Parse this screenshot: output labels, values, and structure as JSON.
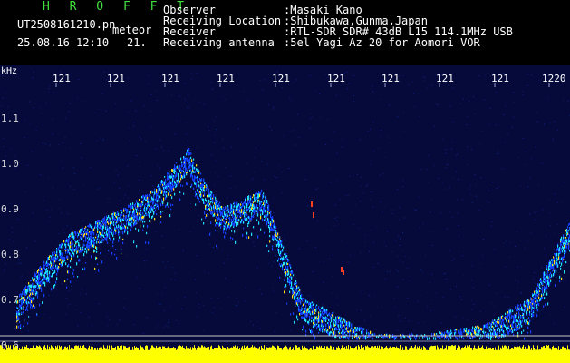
{
  "header": {
    "brand": "H R O F F T",
    "filename": "UT2508161210.pn",
    "type": "meteor",
    "datetime": "25.08.16 12:10",
    "seconds": "21.",
    "rows": [
      {
        "label": "Observer",
        "value": ":Masaki Kano"
      },
      {
        "label": "Receiving Location",
        "value": ":Shibukawa,Gunma,Japan"
      },
      {
        "label": "Receiver",
        "value": ":RTL-SDR SDR# 43dB L15 114.1MHz USB"
      },
      {
        "label": "Receiving antenna",
        "value": ":5el Yagi Az 20 for Aomori VOR"
      }
    ]
  },
  "plot": {
    "y_unit": "kHz",
    "y_ticks": [
      "1.1",
      "1.0",
      "0.9",
      "0.8",
      "0.7",
      "0.6"
    ],
    "x_ticks": [
      "121",
      "121",
      "121",
      "121",
      "121",
      "121",
      "121",
      "121",
      "121",
      "1220"
    ]
  },
  "colors": {
    "background": "#050a3a",
    "trace_low": "#1640ff",
    "trace_mid": "#20e0ff",
    "trace_hot": "#ffe020",
    "baseline": "#ffff00"
  },
  "chart_data": {
    "type": "heatmap",
    "xlabel": "",
    "ylabel": "kHz",
    "ylim": [
      0.58,
      1.16
    ],
    "trace_kHz_by_position": [
      [
        0.0,
        0.62
      ],
      [
        0.03,
        0.68
      ],
      [
        0.07,
        0.75
      ],
      [
        0.12,
        0.82
      ],
      [
        0.17,
        0.85
      ],
      [
        0.22,
        0.88
      ],
      [
        0.27,
        0.92
      ],
      [
        0.31,
        0.98
      ],
      [
        0.33,
        1.01
      ],
      [
        0.36,
        0.93
      ],
      [
        0.39,
        0.88
      ],
      [
        0.43,
        0.9
      ],
      [
        0.46,
        0.92
      ],
      [
        0.5,
        0.78
      ],
      [
        0.53,
        0.68
      ],
      [
        0.58,
        0.65
      ],
      [
        0.62,
        0.62
      ],
      [
        0.66,
        0.6
      ],
      [
        0.75,
        0.6
      ],
      [
        0.85,
        0.62
      ],
      [
        0.93,
        0.68
      ],
      [
        0.97,
        0.78
      ],
      [
        1.0,
        0.85
      ]
    ]
  }
}
